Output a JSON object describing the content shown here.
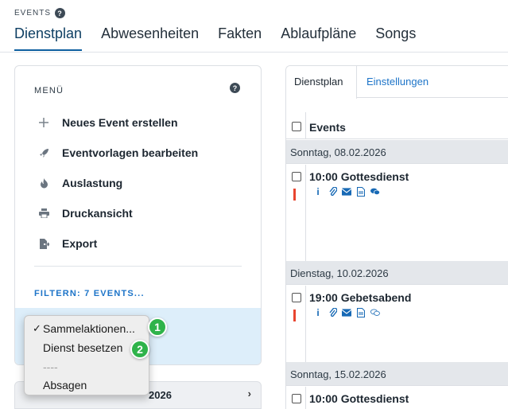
{
  "header": {
    "section": "EVENTS",
    "tabs": [
      "Dienstplan",
      "Abwesenheiten",
      "Fakten",
      "Ablaufpläne",
      "Songs"
    ],
    "active_tab": "Dienstplan"
  },
  "menu": {
    "title": "MENÜ",
    "items": [
      {
        "label": "Neues Event erstellen",
        "icon": "plus-icon"
      },
      {
        "label": "Eventvorlagen bearbeiten",
        "icon": "rocket-icon"
      },
      {
        "label": "Auslastung",
        "icon": "flame-icon"
      },
      {
        "label": "Druckansicht",
        "icon": "printer-icon"
      },
      {
        "label": "Export",
        "icon": "export-icon"
      }
    ],
    "filter": "FILTERN: 7 EVENTS..."
  },
  "dropdown": {
    "options": [
      "Sammelaktionen...",
      "Dienst besetzen",
      "----",
      "Absagen"
    ],
    "selected": "Sammelaktionen...",
    "badges": [
      "1",
      "2"
    ]
  },
  "left_date_strip": {
    "label": "2026",
    "chevron": "›"
  },
  "right": {
    "tabs": [
      "Dienstplan",
      "Einstellungen"
    ],
    "column_header": "Events",
    "days": [
      {
        "label": "Sonntag, 08.02.2026",
        "event": "10:00 Gottesdienst"
      },
      {
        "label": "Dienstag, 10.02.2026",
        "event": "19:00 Gebetsabend"
      },
      {
        "label": "Sonntag, 15.02.2026",
        "event": "10:00 Gottesdienst"
      }
    ]
  },
  "colors": {
    "accent": "#1d74c8",
    "highlight": "#ddeefa",
    "badge": "#2fb34a",
    "flag": "#e8452f"
  }
}
